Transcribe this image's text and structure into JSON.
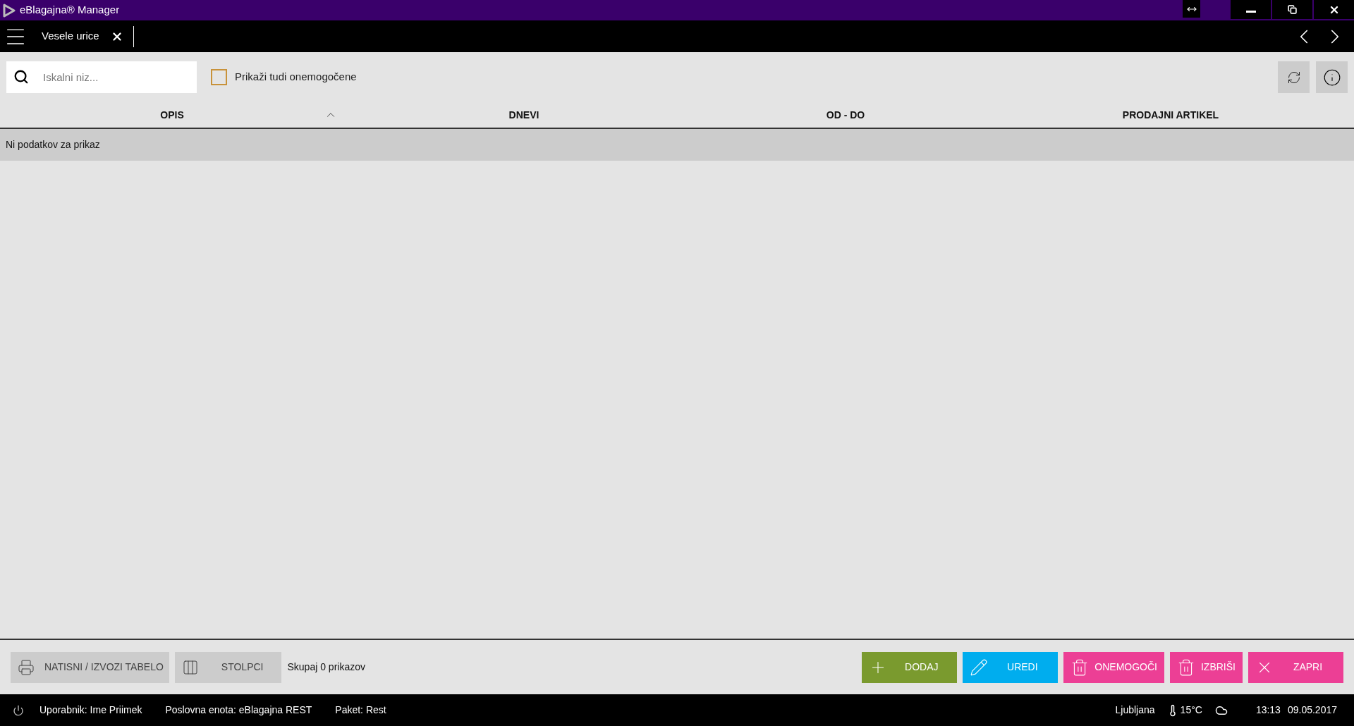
{
  "window": {
    "title": "eBlagajna® Manager"
  },
  "tabs": [
    {
      "label": "Vesele urice",
      "selected": true
    }
  ],
  "search": {
    "placeholder": "Iskalni niz..."
  },
  "show_disabled": {
    "label": "Prikaži tudi onemogočene",
    "checked": false
  },
  "table": {
    "columns": [
      {
        "label": "OPIS",
        "sorted": true
      },
      {
        "label": "DNEVI",
        "sorted": false
      },
      {
        "label": "OD - DO",
        "sorted": false
      },
      {
        "label": "PRODAJNI ARTIKEL",
        "sorted": false
      }
    ],
    "empty_message": "Ni podatkov za prikaz"
  },
  "footer": {
    "tools": [
      {
        "kind": "print",
        "label": "NATISNI / IZVOZI TABELO"
      },
      {
        "kind": "columns",
        "label": "STOLPCI"
      }
    ],
    "total": "Skupaj 0 prikazov",
    "actions": [
      {
        "kind": "add",
        "label": "DODAJ",
        "color": "#7a9a2e"
      },
      {
        "kind": "edit",
        "label": "UREDI",
        "color": "#00adee"
      },
      {
        "kind": "trash",
        "label": "ONEMOGOČI",
        "color": "#ec3f95"
      },
      {
        "kind": "trash",
        "label": "IZBRIŠI",
        "color": "#ec3f95"
      },
      {
        "kind": "close",
        "label": "ZAPRI",
        "color": "#ec3f95"
      }
    ]
  },
  "status_bar": {
    "user": "Uporabnik: Ime Priimek",
    "unit": "Poslovna enota: eBlagajna REST",
    "package": "Paket: Rest",
    "city": "Ljubljana",
    "temperature": "15°C",
    "time": "13:13",
    "date": "09.05.2017"
  }
}
